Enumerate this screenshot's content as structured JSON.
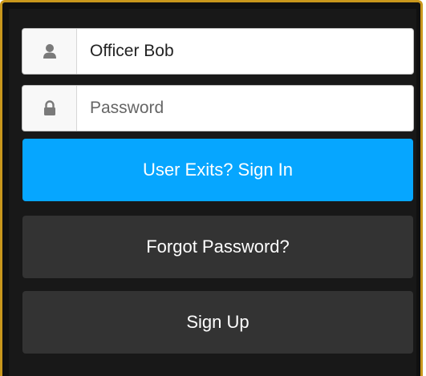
{
  "login_form": {
    "username": {
      "value": "Officer Bob",
      "icon": "user-icon"
    },
    "password": {
      "placeholder": "Password",
      "icon": "lock-icon"
    },
    "sign_in_label": "User Exits? Sign In",
    "forgot_password_label": "Forgot Password?",
    "sign_up_label": "Sign Up"
  },
  "colors": {
    "frame_border": "#c9971c",
    "background": "#181818",
    "primary_button": "#06a6ff",
    "secondary_button": "#333333"
  }
}
